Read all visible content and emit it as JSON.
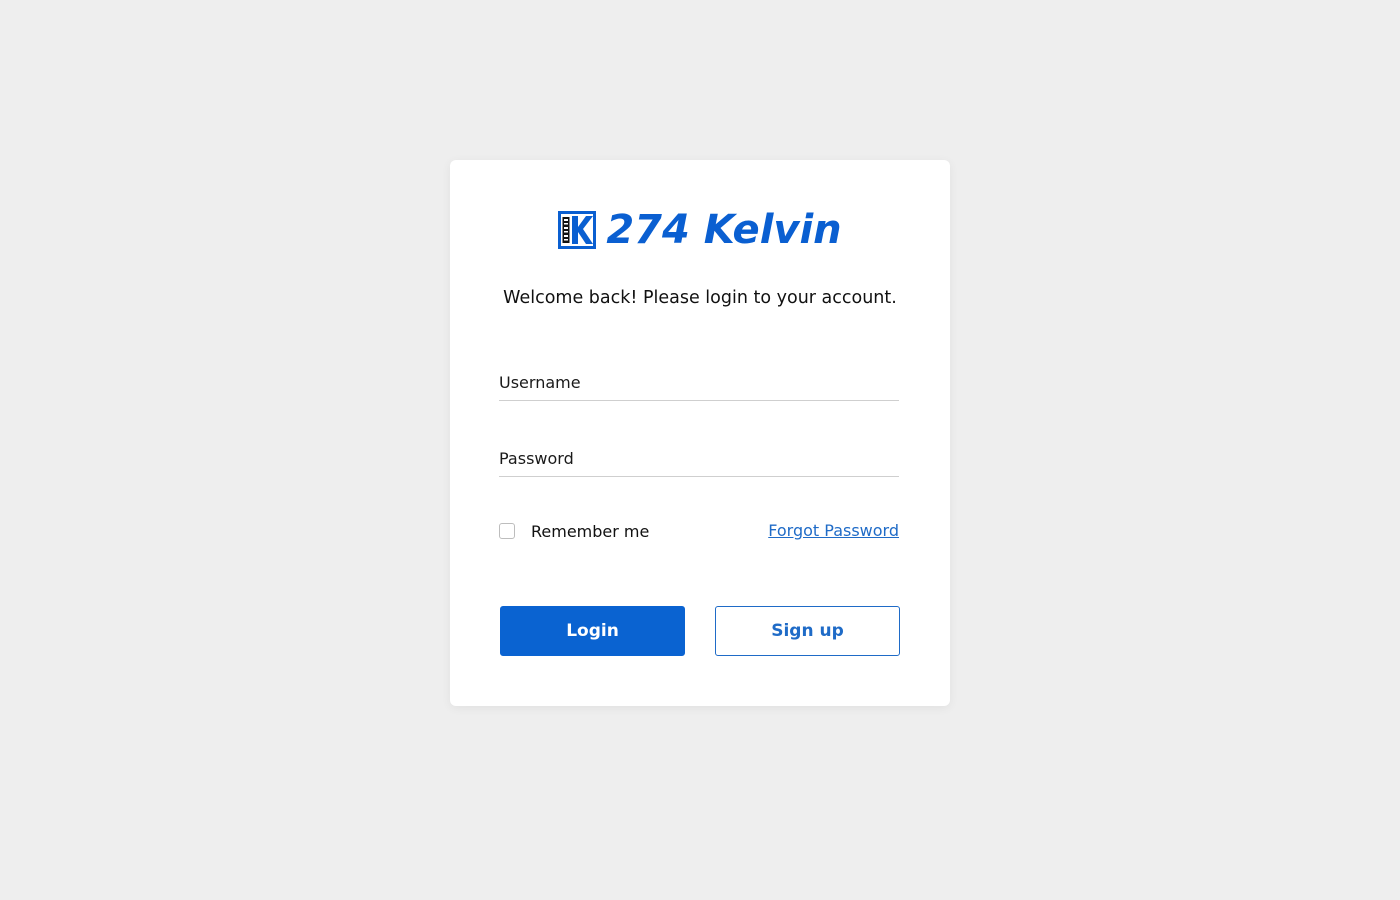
{
  "brand": {
    "name": "274 Kelvin",
    "logo_mark_icon": "k-274-logo-icon",
    "color": "#0a5fd1"
  },
  "welcome_text": "Welcome back! Please login to your account.",
  "form": {
    "username": {
      "placeholder": "Username",
      "value": ""
    },
    "password": {
      "placeholder": "Password",
      "value": ""
    },
    "remember": {
      "label": "Remember me",
      "checked": false
    },
    "forgot_label": "Forgot Password"
  },
  "buttons": {
    "login_label": "Login",
    "signup_label": "Sign up"
  },
  "colors": {
    "accent": "#0a63d1",
    "link": "#1f6bc7",
    "background": "#eeeeee",
    "card": "#ffffff"
  }
}
